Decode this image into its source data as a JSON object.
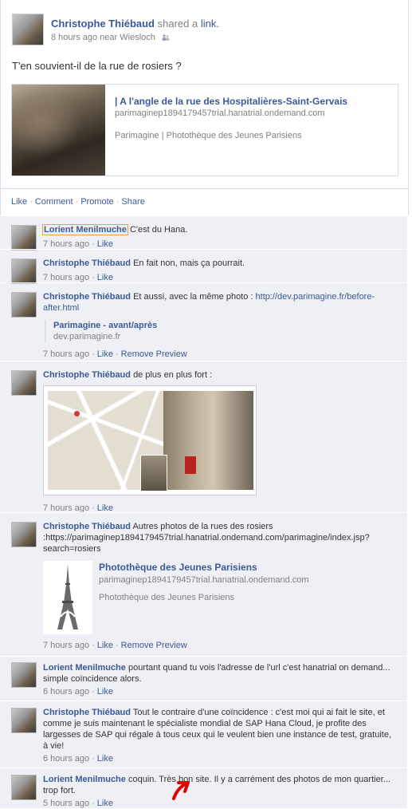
{
  "post": {
    "author": "Christophe Thiébaud",
    "action": "shared a",
    "action_link": "link.",
    "time": "8 hours ago",
    "near": "near",
    "location": "Wiesloch",
    "message": "T'en souvient-il de la rue de rosiers ?",
    "share": {
      "title": "| A l'angle de la rue des Hospitalières-Saint-Gervais",
      "url": "parimaginep1894179457trial.hanatrial.ondemand.com",
      "description": "Parimagine | Photothèque des Jeunes Parisiens"
    }
  },
  "actions": {
    "like": "Like",
    "comment": "Comment",
    "promote": "Promote",
    "share": "Share"
  },
  "comments": [
    {
      "author": "Lorient Menilmuche",
      "text": "C'est du Hana.",
      "time": "7 hours ago",
      "like": "Like"
    },
    {
      "author": "Christophe Thiébaud",
      "text": "En fait non, mais ça pourrait.",
      "time": "7 hours ago",
      "like": "Like"
    },
    {
      "author": "Christophe Thiébaud",
      "text": "Et aussi, avec la même photo : ",
      "link": "http://dev.parimagine.fr/before-after.html",
      "time": "7 hours ago",
      "like": "Like",
      "remove": "Remove Preview",
      "preview": {
        "title": "Parimagine - avant/après",
        "url": "dev.parimagine.fr"
      }
    },
    {
      "author": "Christophe Thiébaud",
      "text": "de plus en plus fort :",
      "time": "7 hours ago",
      "like": "Like"
    },
    {
      "author": "Christophe Thiébaud",
      "text": "Autres photos de la rues des rosiers :",
      "link": "https://parimaginep1894179457trial.hanatrial.ondemand.com/parimagine/index.jsp?search=rosiers",
      "time": "7 hours ago",
      "like": "Like",
      "remove": "Remove Preview",
      "preview": {
        "title": "Photothèque des Jeunes Parisiens",
        "url": "parimaginep1894179457trial.hanatrial.ondemand.com",
        "description": "Photothèque des Jeunes Parisiens"
      }
    },
    {
      "author": "Lorient Menilmuche",
      "text": "pourtant quand tu vois l'adresse de l'url c'est hanatrial on demand... simple coïncidence alors.",
      "time": "6 hours ago",
      "like": "Like"
    },
    {
      "author": "Christophe Thiébaud",
      "text": "Tout le contraire d'une coïncidence : c'est moi qui ai fait le site, et comme je suis maintenant le spécialiste mondial de SAP Hana Cloud, je profite des largesses de SAP qui régale à tous ceux qui le veulent bien une instance de test, gratuite, à vie!",
      "time": "6 hours ago",
      "like": "Like"
    },
    {
      "author": "Lorient Menilmuche",
      "text": "coquin. Très bon site. Il y a carrément des photos de mon quartier... trop fort.",
      "time": "5 hours ago",
      "like": "Like"
    }
  ],
  "colors": {
    "link": "#3b5998",
    "meta": "#808080",
    "comment_bg": "#eef0f5",
    "annotation_arrow": "#e00000"
  }
}
